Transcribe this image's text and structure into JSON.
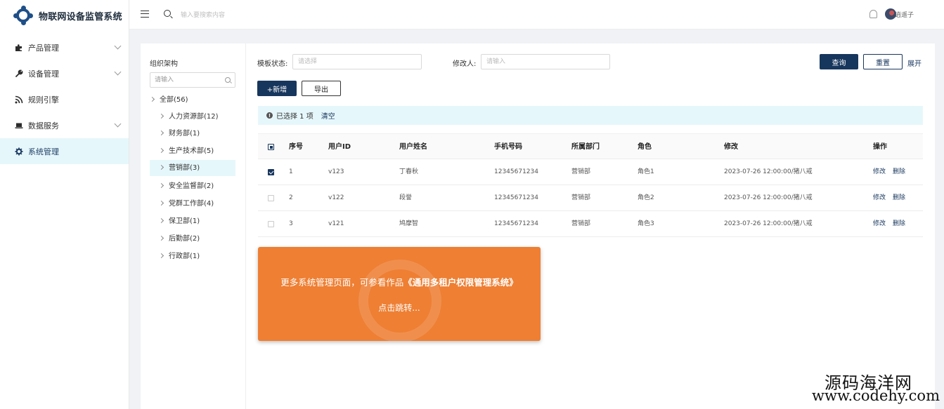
{
  "app": {
    "title": "物联网设备监管系统",
    "brand_color": "#1f4f88"
  },
  "sidebar": {
    "items": [
      {
        "label": "产品管理",
        "icon": "puzzle-icon",
        "has_children": true
      },
      {
        "label": "设备管理",
        "icon": "tools-icon",
        "has_children": true
      },
      {
        "label": "规则引擎",
        "icon": "rss-icon",
        "has_children": false
      },
      {
        "label": "数据服务",
        "icon": "laptop-icon",
        "has_children": true
      },
      {
        "label": "系统管理",
        "icon": "gear-icon",
        "has_children": false,
        "active": true
      }
    ]
  },
  "header": {
    "search_placeholder": "输入要搜索内容",
    "username": "逍遥子"
  },
  "tree": {
    "title": "组织架构",
    "search_placeholder": "请输入",
    "root": "全部(56)",
    "nodes": [
      "人力资源部(12)",
      "财务部(1)",
      "生产技术部(5)",
      "营销部(3)",
      "安全监督部(2)",
      "党群工作部(4)",
      "保卫部(1)",
      "后勤部(2)",
      "行政部(1)"
    ],
    "selected_index": 3
  },
  "filters": {
    "template_status_label": "模板状态:",
    "template_status_placeholder": "请选择",
    "modifier_label": "修改人:",
    "modifier_placeholder": "请输入",
    "query_button": "查询",
    "reset_button": "重置",
    "expand_link": "展开"
  },
  "actions": {
    "add_button": "+新增",
    "export_button": "导出"
  },
  "alert": {
    "text": "已选择 1 项",
    "clear": "清空"
  },
  "table": {
    "columns": [
      "序号",
      "用户ID",
      "用户姓名",
      "手机号码",
      "所属部门",
      "角色",
      "修改",
      "操作"
    ],
    "rows": [
      {
        "checked": true,
        "no": "1",
        "id": "v123",
        "name": "丁春秋",
        "phone": "12345671234",
        "dept": "营销部",
        "role": "角色1",
        "modified": "2023-07-26 12:00:00/猪八戒",
        "edit": "修改",
        "delete": "删除"
      },
      {
        "checked": false,
        "no": "2",
        "id": "v122",
        "name": "段誉",
        "phone": "12345671234",
        "dept": "营销部",
        "role": "角色2",
        "modified": "2023-07-26 12:00:00/猪八戒",
        "edit": "修改",
        "delete": "删除"
      },
      {
        "checked": false,
        "no": "3",
        "id": "v121",
        "name": "鸠摩智",
        "phone": "12345671234",
        "dept": "营销部",
        "role": "角色3",
        "modified": "2023-07-26 12:00:00/猪八戒",
        "edit": "修改",
        "delete": "删除"
      }
    ]
  },
  "promo": {
    "text_prefix": "更多系统管理页面，可参看作品",
    "text_title": "《通用多租户权限管理系统》",
    "sub": "点击跳转...",
    "color": "#ee7f33"
  },
  "watermark": {
    "line1": "源码海洋网",
    "line2": "www.codehy.com"
  }
}
